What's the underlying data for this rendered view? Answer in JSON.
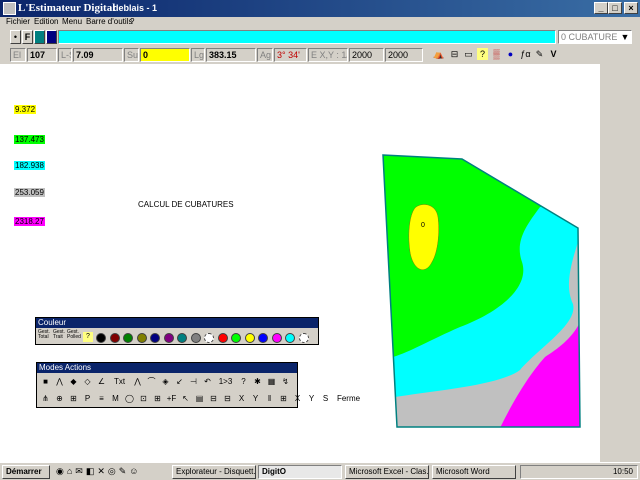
{
  "window": {
    "title": "L'Estimateur Digital",
    "document": "deblais - 1",
    "min": "_",
    "max": "□",
    "close": "×"
  },
  "menu": [
    "Fichier",
    "Edition",
    "Menu",
    "Barre d'outils",
    "?"
  ],
  "toolbar1": {
    "b1": "•",
    "b2": "F",
    "mode": "0 CUBATURE",
    "arrow": "▼"
  },
  "toolbar2": {
    "el_label": "El",
    "el_value": "107",
    "ls_label": "L-S",
    "ls_value": "7.09",
    "su_label": "Su",
    "su_value": "0",
    "lg_label": "Lg",
    "lg_value": "383.15",
    "ag_label": "Ag",
    "ag_value": "3° 34'",
    "exy_label": "E X,Y : 1/",
    "ex_value": "2000",
    "ey_value": "2000",
    "icons": [
      "⛺",
      "⊟",
      "▭",
      "?",
      "▒",
      "●",
      "ƒα",
      "✎",
      "V"
    ]
  },
  "legend": [
    {
      "text": "9.372",
      "color": "#ffff00"
    },
    {
      "text": "137.473",
      "color": "#00ff00"
    },
    {
      "text": "182.938",
      "color": "#00ffff"
    },
    {
      "text": "253.059",
      "color": "#c0c0c0"
    },
    {
      "text": "2318.27",
      "color": "#ff00ff"
    }
  ],
  "canvas_title": "CALCUL DE CUBATURES",
  "map_marker": "0",
  "couleur": {
    "title": "Couleur",
    "buttons": [
      {
        "l1": "Gest.",
        "l2": "Total"
      },
      {
        "l1": "Gest.",
        "l2": "Trait"
      },
      {
        "l1": "Gest.",
        "l2": "Polled"
      }
    ],
    "colors": [
      "#000000",
      "#800000",
      "#008000",
      "#808000",
      "#000080",
      "#800080",
      "#008080",
      "#808080",
      "#ffffff",
      "#ff0000",
      "#00ff00",
      "#ffff00",
      "#0000ff",
      "#ff00ff",
      "#00ffff",
      "#ffffff"
    ]
  },
  "modes": {
    "title": "Modes Actions",
    "row1": [
      "■",
      "⋀",
      "◆",
      "◇",
      "∠",
      "Txt",
      "⋀",
      "⌒",
      "◈",
      "↙",
      "⊣",
      "↶",
      "1>3",
      "?",
      "✱",
      "▦",
      "↯"
    ],
    "row2": [
      "⋔",
      "⊕",
      "⊞",
      "P",
      "≡",
      "M",
      "◯",
      "⊡",
      "⊞",
      "+F",
      "↖",
      "▤",
      "⊟",
      "⊟",
      "X",
      "Y",
      "‖",
      "⊞",
      "X",
      "Y",
      "S",
      "Ferme"
    ]
  },
  "taskbar": {
    "start": "Démarrer",
    "items": [
      "Explorateur - Disquett...",
      "DigitO",
      "Microsoft Excel - Clas...",
      "Microsoft Word"
    ],
    "clock": "10:50"
  }
}
